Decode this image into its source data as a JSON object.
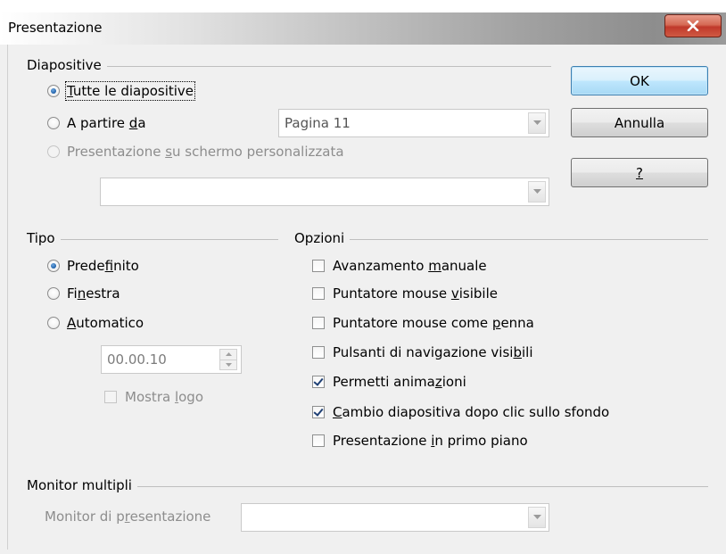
{
  "window": {
    "title": "Presentazione",
    "close_icon": "close-icon"
  },
  "diapositive": {
    "title": "Diapositive",
    "all": {
      "label_prefix": "",
      "label_mnemonic": "T",
      "label_rest": "utte le diapositive",
      "checked": true
    },
    "from": {
      "label_prefix": "A partire ",
      "label_mnemonic": "d",
      "label_rest": "a",
      "checked": false
    },
    "from_value": "Pagina 11",
    "custom": {
      "label_prefix": "Presentazione ",
      "label_mnemonic": "s",
      "label_rest": "u schermo personalizzata",
      "checked": false,
      "disabled": true
    },
    "custom_value": ""
  },
  "buttons": {
    "ok": "OK",
    "cancel": "Annulla",
    "help": "?"
  },
  "tipo": {
    "title": "Tipo",
    "default": {
      "label_prefix": "Prede",
      "label_mnemonic": "f",
      "label_rest": "inito",
      "checked": true
    },
    "window": {
      "label_prefix": "Fi",
      "label_mnemonic": "n",
      "label_rest": "estra",
      "checked": false
    },
    "auto": {
      "label_prefix": "",
      "label_mnemonic": "A",
      "label_rest": "utomatico",
      "checked": false
    },
    "pause_value": "00.00.10",
    "show_logo": {
      "label_prefix": "Mostra ",
      "label_mnemonic": "l",
      "label_rest": "ogo",
      "checked": false,
      "disabled": true
    }
  },
  "opzioni": {
    "title": "Opzioni",
    "items": [
      {
        "label_prefix": "Avanzamento ",
        "label_mnemonic": "m",
        "label_rest": "anuale",
        "checked": false
      },
      {
        "label_prefix": "Puntatore mouse ",
        "label_mnemonic": "v",
        "label_rest": "isibile",
        "checked": false
      },
      {
        "label_prefix": "Puntatore mouse come ",
        "label_mnemonic": "p",
        "label_rest": "enna",
        "checked": false
      },
      {
        "label_prefix": "Pulsanti di navigazione visi",
        "label_mnemonic": "b",
        "label_rest": "ili",
        "checked": false
      },
      {
        "label_prefix": "Permetti anima",
        "label_mnemonic": "z",
        "label_rest": "ioni",
        "checked": true
      },
      {
        "label_prefix": "",
        "label_mnemonic": "C",
        "label_rest": "ambio diapositiva dopo clic sullo sfondo",
        "checked": true
      },
      {
        "label_prefix": "Presentazione ",
        "label_mnemonic": "i",
        "label_rest": "n primo piano",
        "checked": false
      }
    ]
  },
  "monitor": {
    "title": "Monitor multipli",
    "label_prefix": "Monitor di p",
    "label_mnemonic": "r",
    "label_rest": "esentazione",
    "value": ""
  }
}
